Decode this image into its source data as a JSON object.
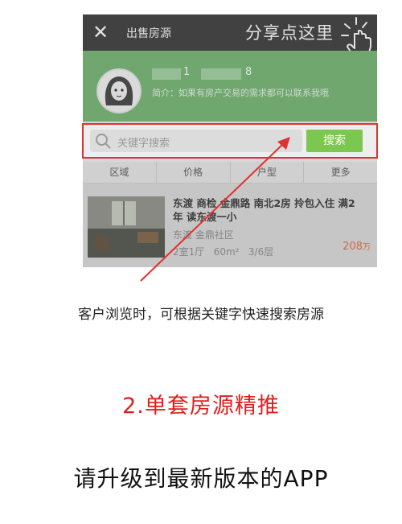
{
  "header": {
    "close_icon": "close-icon",
    "title": "出售房源",
    "share_hint": "分享点这里",
    "hand_icon": "tap-hand-icon"
  },
  "profile": {
    "name_digit_first": "1",
    "name_digit_last": "8",
    "intro": "简介：如果有房产交易的需求都可以联系我哦"
  },
  "search": {
    "placeholder": "关键字搜索",
    "button": "搜索",
    "highlight_color": "#e03131"
  },
  "filters": [
    "区域",
    "价格",
    "户型",
    "更多"
  ],
  "listing": {
    "title": "东渡 商检 金鼎路 南北2房 拎包入住 满2年 读东渡一小",
    "estate": "东渡 金鼎社区",
    "specs": "2室1厅   60m²   3/6层",
    "price": "208",
    "price_unit": "万"
  },
  "caption": "客户浏览时，可根据关键字快速搜索房源",
  "feature_title": "2.单套房源精推",
  "upgrade_notice": "请升级到最新版本的APP",
  "colors": {
    "titlebar": "#333333",
    "profile_bg": "#6eb56e",
    "search_button": "#7cc74f",
    "accent_red": "#e01e1e"
  }
}
